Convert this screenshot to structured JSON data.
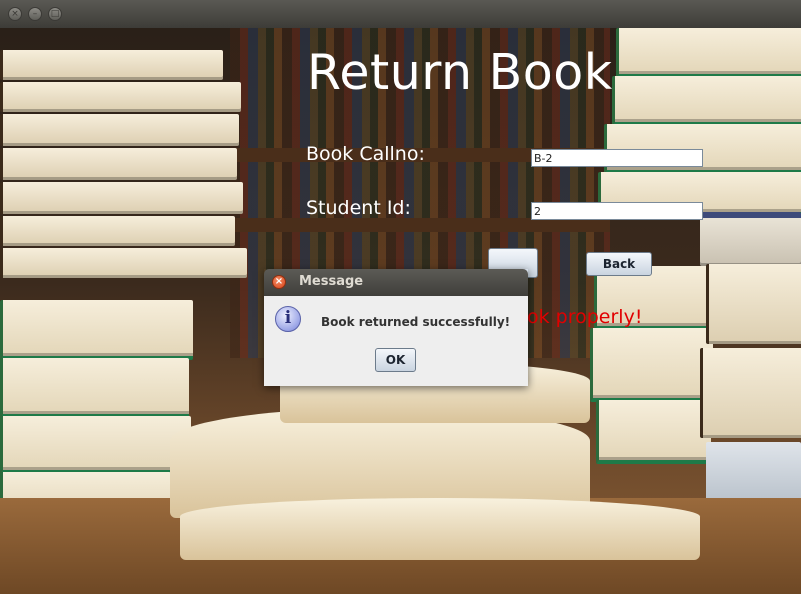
{
  "window": {
    "controls": [
      "close-icon",
      "minimize-icon",
      "maximize-icon"
    ]
  },
  "form": {
    "title": "Return Book",
    "callno_label": "Book Callno:",
    "callno_value": "B-2",
    "student_label": "Student Id:",
    "student_value": "2",
    "back_label": "Back",
    "error_partial": "ok properly!"
  },
  "dialog": {
    "title": "Message",
    "icon": "info-icon",
    "message": "Book returned successfully!",
    "ok_label": "OK"
  },
  "colors": {
    "label_text": "#ffffff",
    "error_text": "#e10000",
    "dialog_bg": "#eeeeee",
    "titlebar": "#3f3e3a"
  }
}
